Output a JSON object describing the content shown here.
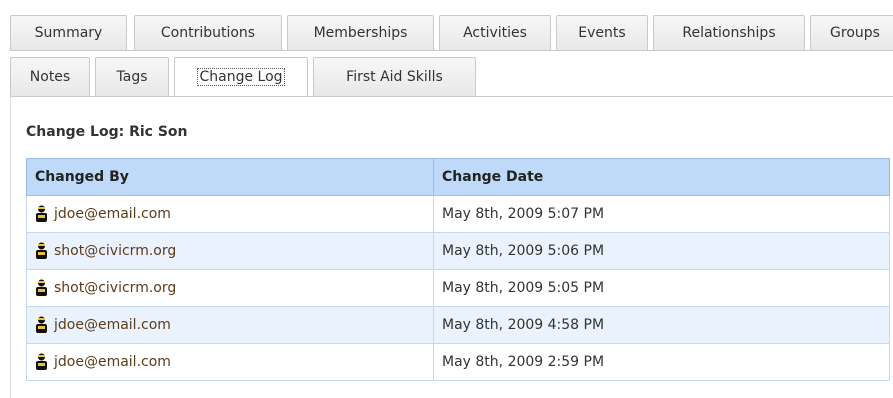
{
  "tabs": {
    "row1": [
      {
        "label": "Summary"
      },
      {
        "label": "Contributions"
      },
      {
        "label": "Memberships"
      },
      {
        "label": "Activities"
      },
      {
        "label": "Events"
      },
      {
        "label": "Relationships"
      },
      {
        "label": "Groups"
      }
    ],
    "row2": [
      {
        "label": "Notes"
      },
      {
        "label": "Tags"
      },
      {
        "label": "Change Log",
        "active": true
      },
      {
        "label": "First Aid Skills"
      }
    ]
  },
  "change_log": {
    "title": "Change Log: Ric Son",
    "headers": {
      "changed_by": "Changed By",
      "change_date": "Change Date"
    },
    "rows": [
      {
        "user": "jdoe@email.com",
        "date": "May 8th, 2009 5:07 PM"
      },
      {
        "user": "shot@civicrm.org",
        "date": "May 8th, 2009 5:06 PM"
      },
      {
        "user": "shot@civicrm.org",
        "date": "May 8th, 2009 5:05 PM"
      },
      {
        "user": "jdoe@email.com",
        "date": "May 8th, 2009 4:58 PM"
      },
      {
        "user": "jdoe@email.com",
        "date": "May 8th, 2009 2:59 PM"
      }
    ]
  },
  "icons": {
    "user": "contact-person-icon"
  },
  "colors": {
    "header_bg": "#bfd9f8",
    "alt_row_bg": "#e9f2fd",
    "link": "#5d3a1a"
  }
}
